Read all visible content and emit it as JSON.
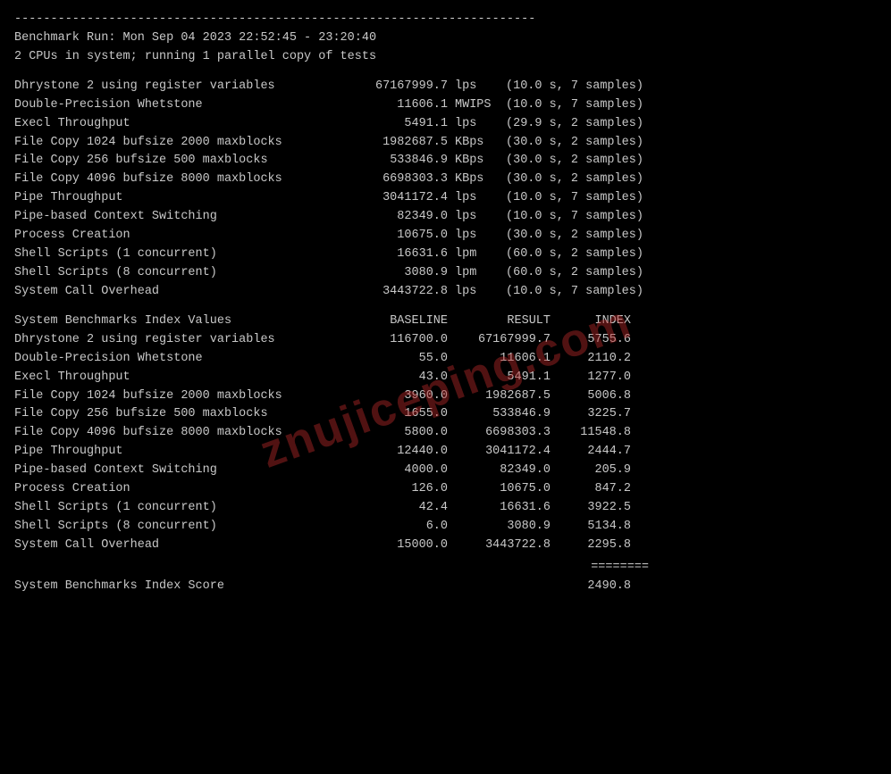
{
  "separator": "------------------------------------------------------------------------",
  "header": {
    "line1": "Benchmark Run: Mon Sep 04 2023 22:52:45 - 23:20:40",
    "line2": "2 CPUs in system; running 1 parallel copy of tests"
  },
  "benchmarks": [
    {
      "label": "Dhrystone 2 using register variables",
      "value": "67167999.7",
      "unit": "lps",
      "samples": "(10.0 s, 7 samples)"
    },
    {
      "label": "Double-Precision Whetstone",
      "value": "11606.1",
      "unit": "MWIPS",
      "samples": "(10.0 s, 7 samples)"
    },
    {
      "label": "Execl Throughput",
      "value": "5491.1",
      "unit": "lps",
      "samples": "(29.9 s, 2 samples)"
    },
    {
      "label": "File Copy 1024 bufsize 2000 maxblocks",
      "value": "1982687.5",
      "unit": "KBps",
      "samples": "(30.0 s, 2 samples)"
    },
    {
      "label": "File Copy 256 bufsize 500 maxblocks",
      "value": "533846.9",
      "unit": "KBps",
      "samples": "(30.0 s, 2 samples)"
    },
    {
      "label": "File Copy 4096 bufsize 8000 maxblocks",
      "value": "6698303.3",
      "unit": "KBps",
      "samples": "(30.0 s, 2 samples)"
    },
    {
      "label": "Pipe Throughput",
      "value": "3041172.4",
      "unit": "lps",
      "samples": "(10.0 s, 7 samples)"
    },
    {
      "label": "Pipe-based Context Switching",
      "value": "82349.0",
      "unit": "lps",
      "samples": "(10.0 s, 7 samples)"
    },
    {
      "label": "Process Creation",
      "value": "10675.0",
      "unit": "lps",
      "samples": "(30.0 s, 2 samples)"
    },
    {
      "label": "Shell Scripts (1 concurrent)",
      "value": "16631.6",
      "unit": "lpm",
      "samples": "(60.0 s, 2 samples)"
    },
    {
      "label": "Shell Scripts (8 concurrent)",
      "value": "3080.9",
      "unit": "lpm",
      "samples": "(60.0 s, 2 samples)"
    },
    {
      "label": "System Call Overhead",
      "value": "3443722.8",
      "unit": "lps",
      "samples": "(10.0 s, 7 samples)"
    }
  ],
  "index_header": {
    "label": "System Benchmarks Index Values",
    "baseline": "BASELINE",
    "result": "RESULT",
    "index": "INDEX"
  },
  "index_rows": [
    {
      "label": "Dhrystone 2 using register variables",
      "baseline": "116700.0",
      "result": "67167999.7",
      "index": "5755.6"
    },
    {
      "label": "Double-Precision Whetstone",
      "baseline": "55.0",
      "result": "11606.1",
      "index": "2110.2"
    },
    {
      "label": "Execl Throughput",
      "baseline": "43.0",
      "result": "5491.1",
      "index": "1277.0"
    },
    {
      "label": "File Copy 1024 bufsize 2000 maxblocks",
      "baseline": "3960.0",
      "result": "1982687.5",
      "index": "5006.8"
    },
    {
      "label": "File Copy 256 bufsize 500 maxblocks",
      "baseline": "1655.0",
      "result": "533846.9",
      "index": "3225.7"
    },
    {
      "label": "File Copy 4096 bufsize 8000 maxblocks",
      "baseline": "5800.0",
      "result": "6698303.3",
      "index": "11548.8"
    },
    {
      "label": "Pipe Throughput",
      "baseline": "12440.0",
      "result": "3041172.4",
      "index": "2444.7"
    },
    {
      "label": "Pipe-based Context Switching",
      "baseline": "4000.0",
      "result": "82349.0",
      "index": "205.9"
    },
    {
      "label": "Process Creation",
      "baseline": "126.0",
      "result": "10675.0",
      "index": "847.2"
    },
    {
      "label": "Shell Scripts (1 concurrent)",
      "baseline": "42.4",
      "result": "16631.6",
      "index": "3922.5"
    },
    {
      "label": "Shell Scripts (8 concurrent)",
      "baseline": "6.0",
      "result": "3080.9",
      "index": "5134.8"
    },
    {
      "label": "System Call Overhead",
      "baseline": "15000.0",
      "result": "3443722.8",
      "index": "2295.8"
    }
  ],
  "equals_line": "========",
  "score_label": "System Benchmarks Index Score",
  "score_value": "2490.8",
  "watermark": "znujiceping.com"
}
